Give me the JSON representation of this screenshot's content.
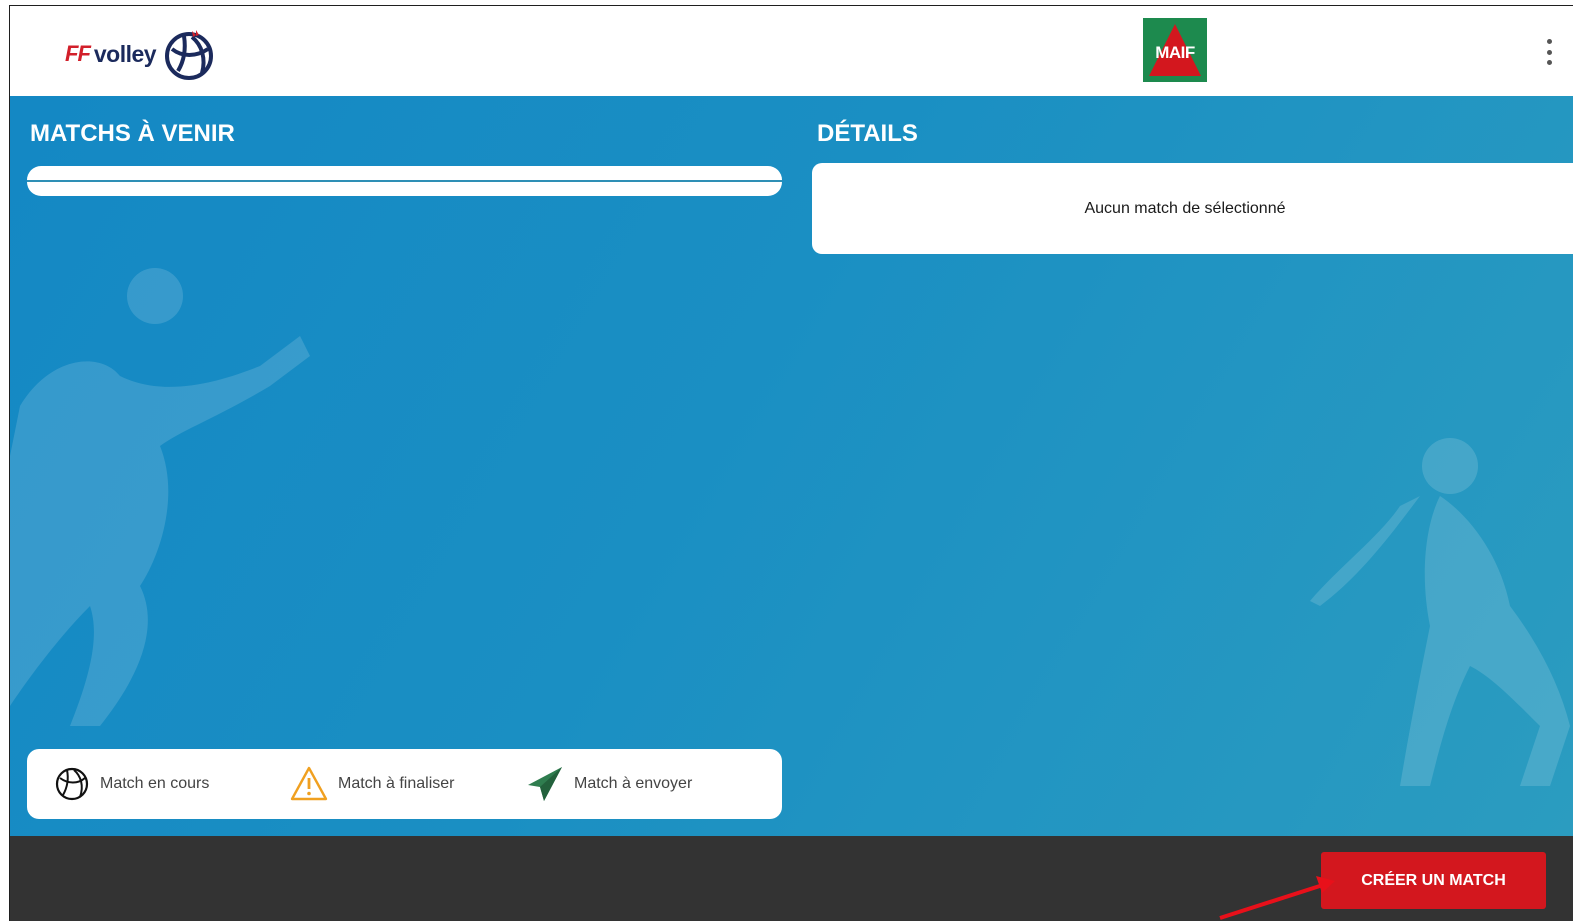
{
  "header": {
    "brand_prefix": "FF",
    "brand_name": "volley",
    "sponsor": "MAIF",
    "menu_icon": "more-vert-icon"
  },
  "upcoming": {
    "title": "MATCHS À VENIR"
  },
  "details": {
    "title": "DÉTAILS",
    "empty_message": "Aucun match de sélectionné"
  },
  "legend": {
    "items": [
      {
        "icon": "volleyball-icon",
        "label": "Match en cours"
      },
      {
        "icon": "warning-icon",
        "label": "Match à finaliser"
      },
      {
        "icon": "paper-plane-icon",
        "label": "Match à envoyer"
      }
    ]
  },
  "footer": {
    "create_button": "CRÉER UN MATCH"
  },
  "colors": {
    "brand_blue": "#1b2a5c",
    "brand_red": "#d21f2a",
    "main_blue": "#1a8fc3",
    "button_red": "#d3171e",
    "footer_dark": "#333333",
    "sponsor_green": "#1d8a4e",
    "warning_orange": "#f0a020",
    "send_green": "#2f7d4f"
  }
}
